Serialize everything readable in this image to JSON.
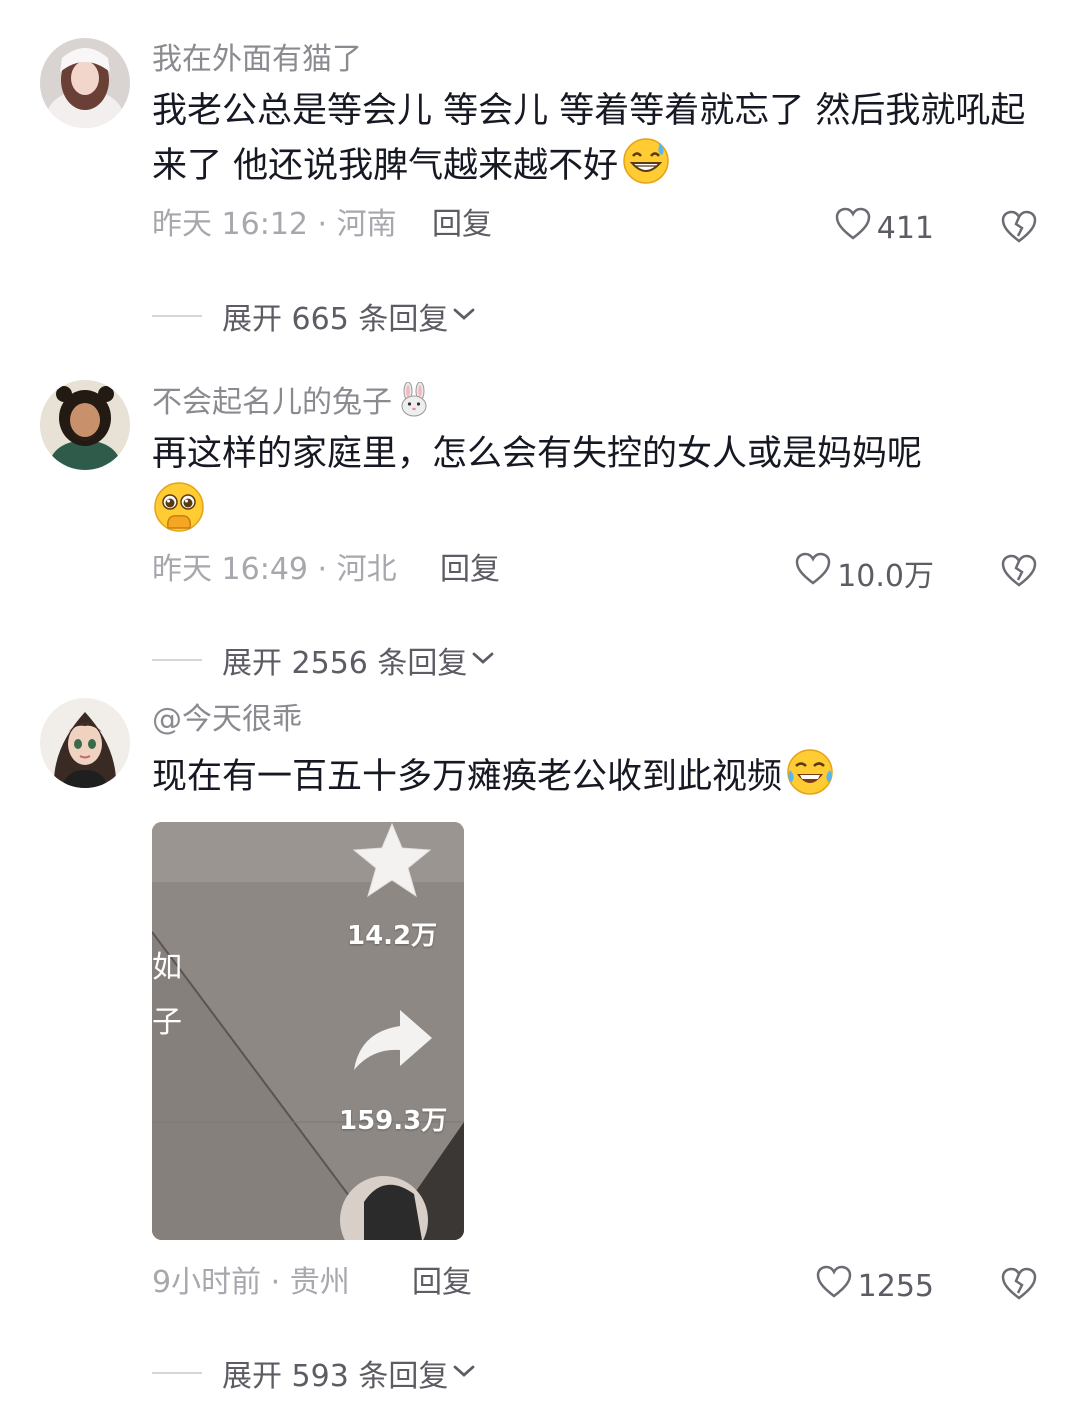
{
  "colors": {
    "text_primary": "#161823",
    "text_secondary": "#8a8b91",
    "text_meta": "#a7a8ad",
    "action": "#5c5d64"
  },
  "comments": [
    {
      "username": "我在外面有猫了",
      "content": "我老公总是等会儿 等会儿 等着等着就忘了 然后我就吼起来了 他还说我脾气越来越不好",
      "emoji": "grinning-sweat-emoji",
      "time_location": "昨天 16:12 · 河南",
      "reply_label": "回复",
      "likes": "411",
      "expand_label": "展开 665 条回复",
      "avatar": "girl-avatar"
    },
    {
      "username": "不会起名儿的兔子",
      "username_emoji": "rabbit-face-emoji",
      "content": "再这样的家庭里，怎么会有失控的女人或是妈妈呢",
      "emoji": "pleading-hand-over-mouth-emoji",
      "time_location": "昨天 16:49 · 河北",
      "reply_label": "回复",
      "likes": "10.0万",
      "expand_label": "展开 2556 条回复",
      "avatar": "bearded-man-avatar"
    },
    {
      "username": "@今天很乖",
      "content": "现在有一百五十多万瘫痪老公收到此视频",
      "emoji": "tears-of-joy-emoji",
      "time_location": "9小时前 · 贵州",
      "reply_label": "回复",
      "likes": "1255",
      "expand_label": "展开 593 条回复",
      "avatar": "cartoon-girl-avatar",
      "media": {
        "favorite_count": "14.2万",
        "share_count": "159.3万",
        "side_chars": [
          "如",
          "子"
        ]
      }
    }
  ]
}
